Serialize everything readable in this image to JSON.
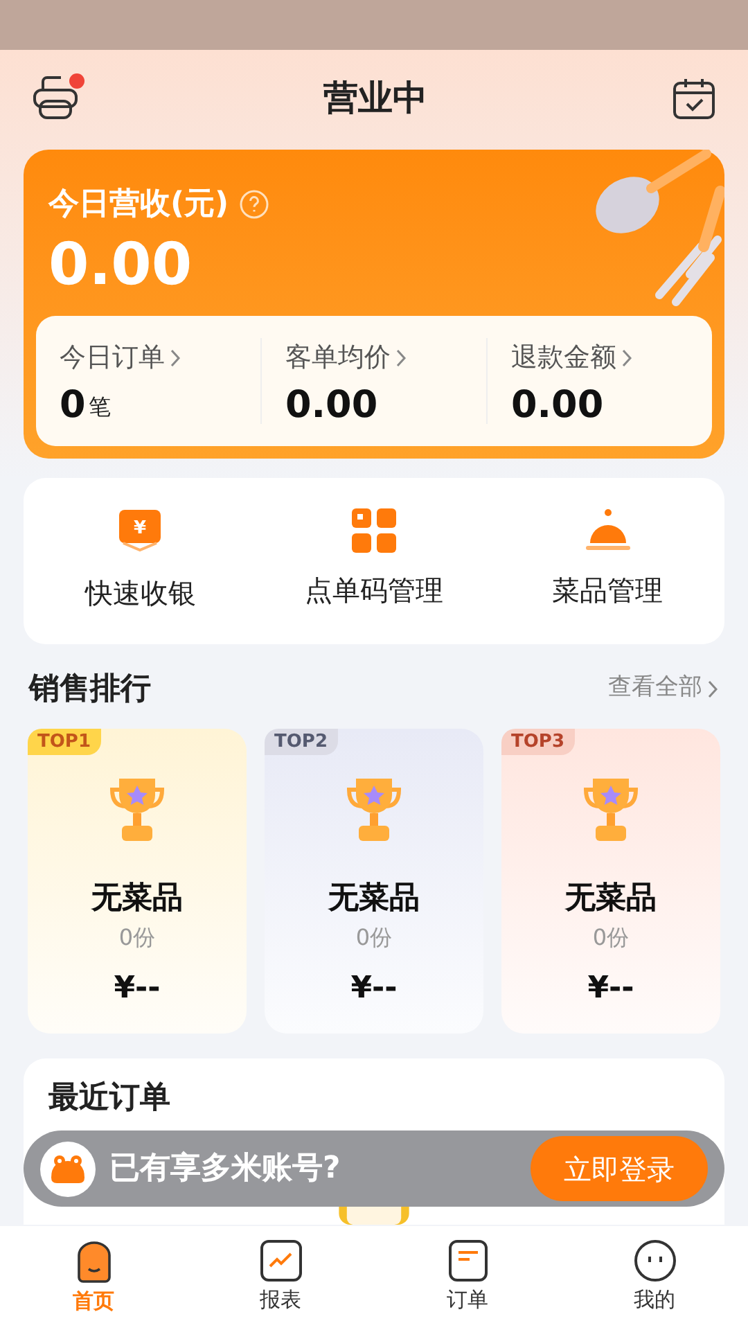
{
  "header": {
    "title": "营业中",
    "printer_alert": true
  },
  "revenue": {
    "label": "今日营收(元)",
    "amount": "0.00",
    "stats": [
      {
        "label": "今日订单",
        "value": "0",
        "unit": "笔"
      },
      {
        "label": "客单均价",
        "value": "0.00"
      },
      {
        "label": "退款金额",
        "value": "0.00"
      }
    ]
  },
  "quick_actions": [
    {
      "kind": "cashier",
      "glyph": "¥",
      "label": "快速收银"
    },
    {
      "kind": "qrcode",
      "label": "点单码管理"
    },
    {
      "kind": "dish",
      "label": "菜品管理"
    }
  ],
  "sales_ranking": {
    "title": "销售排行",
    "link": "查看全部",
    "items": [
      {
        "rank": "TOP1",
        "kind": "gold",
        "name": "无菜品",
        "count": "0份",
        "price": "¥--"
      },
      {
        "rank": "TOP2",
        "kind": "silver",
        "name": "无菜品",
        "count": "0份",
        "price": "¥--"
      },
      {
        "rank": "TOP3",
        "kind": "bronze",
        "name": "无菜品",
        "count": "0份",
        "price": "¥--"
      }
    ]
  },
  "recent_orders": {
    "title": "最近订单"
  },
  "login_prompt": {
    "text": "已有享多米账号?",
    "button": "立即登录"
  },
  "tab_bar": [
    {
      "kind": "home",
      "label": "首页",
      "selected": true
    },
    {
      "kind": "report",
      "label": "报表",
      "selected": false
    },
    {
      "kind": "orders",
      "label": "订单",
      "selected": false
    },
    {
      "kind": "mine",
      "label": "我的",
      "selected": false
    }
  ]
}
